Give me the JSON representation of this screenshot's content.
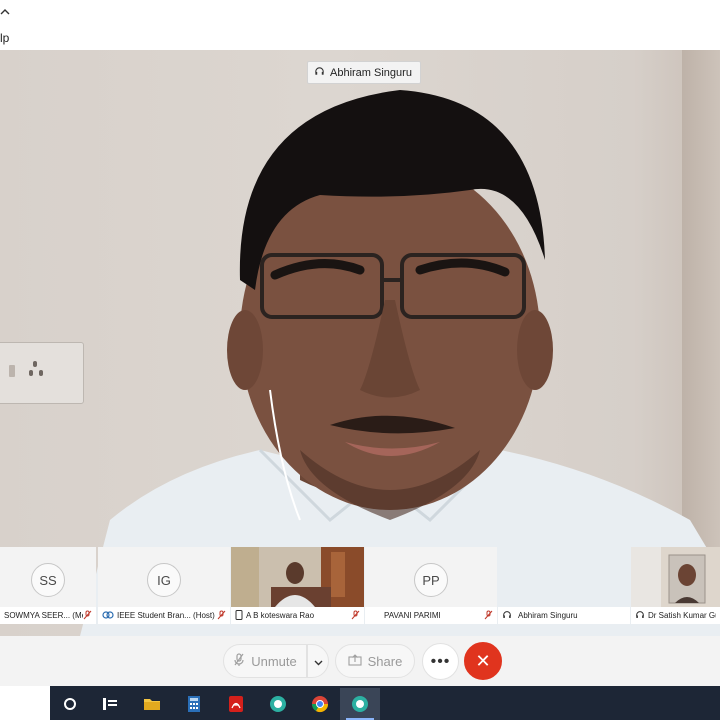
{
  "window": {
    "help_label": "lp",
    "collapse_icon": "chevron-up-icon"
  },
  "active_speaker": {
    "name": "Abhiram Singuru",
    "icon": "headset-icon"
  },
  "participants": [
    {
      "initials": "SS",
      "name": "SOWMYA SEER... (Me)",
      "mic": "muted",
      "type": "avatar"
    },
    {
      "initials": "IG",
      "name": "IEEE Student Bran... (Host)",
      "mic": "muted",
      "type": "avatar"
    },
    {
      "initials": "",
      "name": "A B koteswara Rao",
      "mic": "muted",
      "type": "video"
    },
    {
      "initials": "PP",
      "name": "PAVANI PARIMI",
      "mic": "muted",
      "type": "avatar"
    },
    {
      "initials": "",
      "name": "Abhiram Singuru",
      "mic": "headset",
      "type": "blank"
    },
    {
      "initials": "",
      "name": "Dr Satish Kumar Gu",
      "mic": "headset",
      "type": "video"
    }
  ],
  "controls": {
    "unmute_label": "Unmute",
    "share_label": "Share",
    "more_label": "•••",
    "end_label": "✕"
  },
  "taskbar": {
    "items": [
      "cortana-icon",
      "task-view-icon",
      "file-explorer-icon",
      "calculator-icon",
      "acrobat-icon",
      "meeting-app-icon",
      "chrome-icon",
      "meeting-app-active-icon"
    ]
  },
  "colors": {
    "end_call": "#e0341e",
    "taskbar": "#1d2636",
    "strip": "#f3f3f3"
  }
}
